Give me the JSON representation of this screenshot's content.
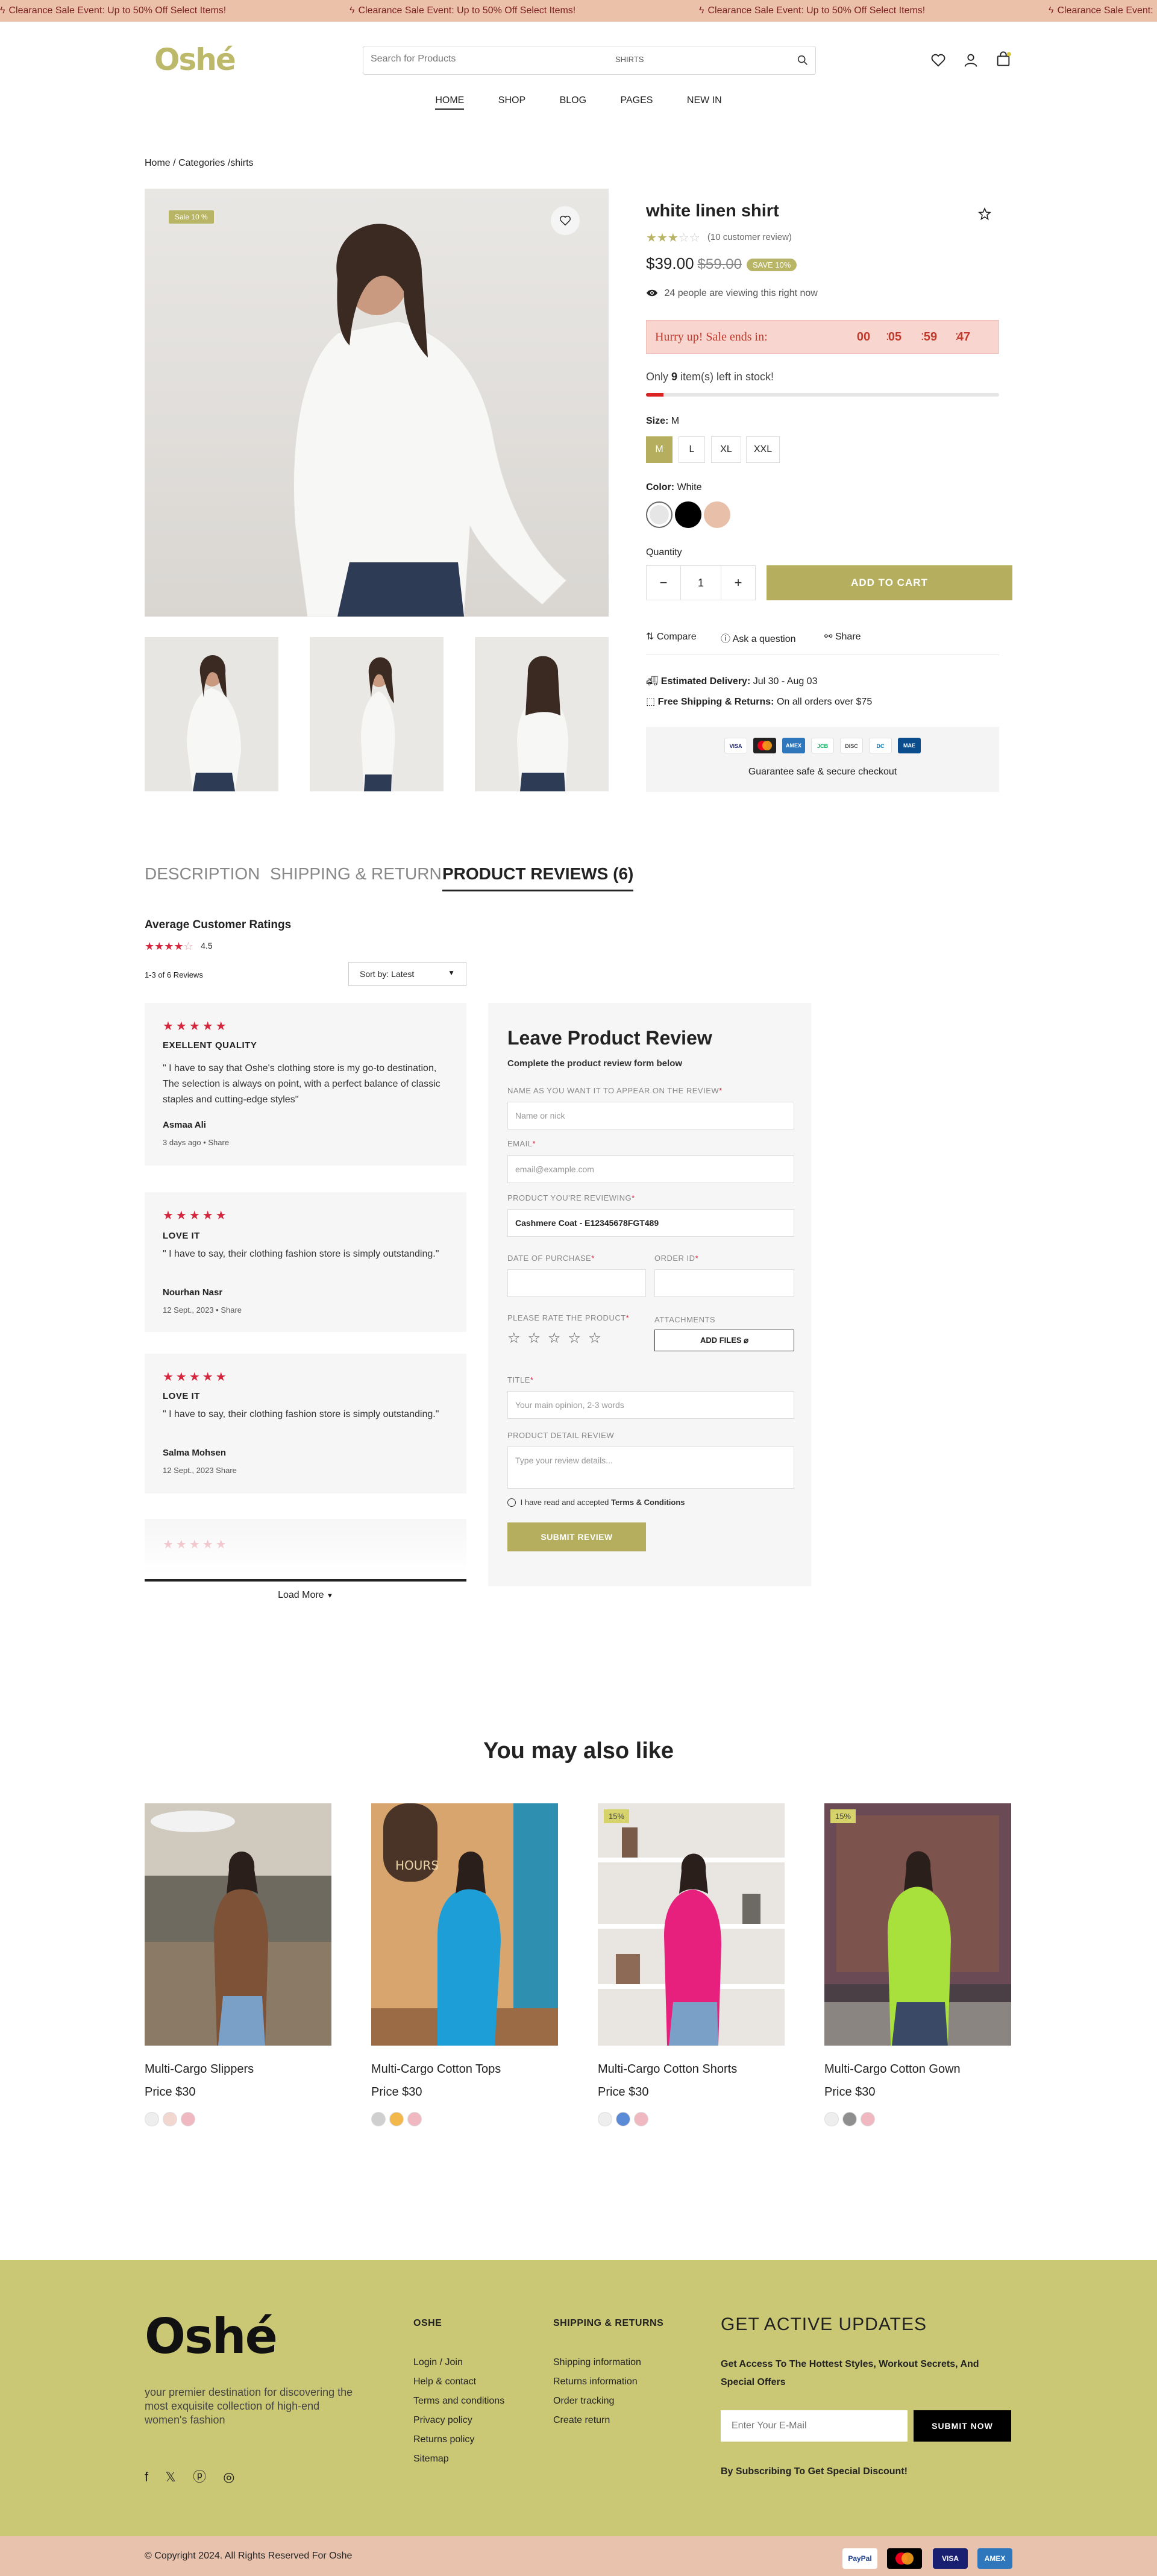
{
  "announcement": {
    "text": "Clearance Sale Event: Up to 50% Off Select Items!",
    "text2": "Clearance Sale Event: Up to 50% Off Select Items!",
    "text3": "Clearance Sale Event: Up to 50% Off Select Items!",
    "text4": "Clearance Sale Event:"
  },
  "header": {
    "logo": "Oshé",
    "search_placeholder": "Search for Products",
    "search_category": "SHIRTS",
    "nav": [
      "HOME",
      "SHOP",
      "BLOG",
      "PAGES",
      "NEW IN"
    ]
  },
  "breadcrumb": "Home / Categories /shirts",
  "product": {
    "sale_badge": "Sale 10 %",
    "title": "white linen shirt",
    "rating_value": 3,
    "review_count": "(10 customer review)",
    "price": "$39.00",
    "old_price": "$59.00",
    "save_badge": "SAVE 10%",
    "viewing": "24 people are viewing this right now",
    "hurry_label": "Hurry up! Sale ends in:",
    "countdown": [
      "00",
      "05",
      "59",
      "47"
    ],
    "stock_prefix": "Only ",
    "stock_count": "9",
    "stock_suffix": " item(s) left in stock!",
    "stock_fill_fraction": 0.05,
    "size_label": "Size:",
    "size_value": "M",
    "sizes": [
      "M",
      "L",
      "XL",
      "XXL"
    ],
    "color_label": "Color:",
    "color_value": "White",
    "colors": [
      "#e6e6e6",
      "#000000",
      "#e8c0aa"
    ],
    "quantity_label": "Quantity",
    "quantity": "1",
    "add_to_cart": "ADD TO CART",
    "compare": "Compare",
    "ask": "Ask a question",
    "share": "Share",
    "delivery_label": "Estimated Delivery:",
    "delivery_value": "Jul 30 - Aug 03",
    "shipping_label": "Free Shipping & Returns:",
    "shipping_value": "On all orders over $75",
    "secure_text": "Guarantee safe & secure checkout",
    "payment_cards": [
      "VISA",
      "MC",
      "AMEX",
      "JCB",
      "DISC",
      "DC",
      "MAE"
    ]
  },
  "tabs": [
    "DESCRIPTION",
    "SHIPPING & RETURN",
    "PRODUCT REVIEWS (6)"
  ],
  "reviews_summary": {
    "title": "Average Customer Ratings",
    "rating": "4.5",
    "count_text": "1-3 of 6 Reviews",
    "sort_label": "Sort by: Latest"
  },
  "reviews": [
    {
      "title": "EXELLENT QUALITY",
      "body": "\" I have to say that Oshe's clothing store is my go-to destination, The selection is always on point, with a perfect balance of classic staples and cutting-edge styles\"",
      "author": "Asmaa Ali",
      "meta": "3 days ago  •  Share"
    },
    {
      "title": "LOVE IT",
      "body": "\" I have to say, their clothing fashion store is simply outstanding.\"",
      "author": "Nourhan Nasr",
      "meta": "12 Sept., 2023  •  Share"
    },
    {
      "title": "LOVE IT",
      "body": "\" I have to say, their clothing fashion store is simply outstanding.\"",
      "author": "Salma Mohsen",
      "meta": "12 Sept., 2023     Share"
    }
  ],
  "load_more": "Load More",
  "review_form": {
    "heading": "Leave Product Review",
    "subheading": "Complete the product review form below",
    "name_label": "NAME AS YOU WANT IT TO APPEAR ON THE REVIEW",
    "name_placeholder": "Name or nick",
    "email_label": "EMAIL",
    "email_placeholder": "email@example.com",
    "product_label": "PRODUCT YOU'RE REVIEWING",
    "product_value": "Cashmere Coat - E12345678FGT489",
    "date_label": "DATE OF PURCHASE",
    "order_label": "ORDER ID",
    "rate_label": "PLEASE RATE THE PRODUCT",
    "attach_label": "ATTACHMENTS",
    "attach_button": "ADD FILES",
    "title_label": "TITLE",
    "title_placeholder": "Your main opinion, 2-3 words",
    "detail_label": "PRODUCT DETAIL REVIEW",
    "detail_placeholder": "Type your review details...",
    "terms_text": "I have read and accepted",
    "terms_link": "Terms & Conditions",
    "submit": "SUBMIT REVIEW"
  },
  "related": {
    "heading": "You may also like",
    "items": [
      {
        "name": "Multi-Cargo Slippers",
        "price": "Price $30",
        "badge": "",
        "swatches": [
          "#eeeeee",
          "#f2d6d0",
          "#f0b8c0"
        ]
      },
      {
        "name": "Multi-Cargo Cotton Tops",
        "price": "Price $30",
        "badge": "",
        "swatches": [
          "#cfcfcf",
          "#f2b84b",
          "#f0b8c0"
        ]
      },
      {
        "name": "Multi-Cargo Cotton Shorts",
        "price": "Price $30",
        "badge": "15%",
        "swatches": [
          "#eeeeee",
          "#5b8ad6",
          "#f0b8c0"
        ]
      },
      {
        "name": "Multi-Cargo Cotton Gown",
        "price": "Price $30",
        "badge": "15%",
        "swatches": [
          "#eeeeee",
          "#8f8f8f",
          "#f0b8c0"
        ]
      }
    ]
  },
  "footer": {
    "logo": "Oshé",
    "tagline": "your premier destination for discovering the most exquisite collection of high-end women's fashion",
    "col1_title": "OSHE",
    "col1_links": [
      "Login / Join",
      "Help & contact",
      "Terms and conditions",
      "Privacy policy",
      "Returns policy",
      "Sitemap"
    ],
    "col2_title": "SHIPPING & RETURNS",
    "col2_links": [
      "Shipping information",
      "Returns information",
      "Order tracking",
      "Create return"
    ],
    "updates_title": "GET ACTIVE UPDATES",
    "updates_text": "Get Access To The Hottest Styles, Workout Secrets, And Special Offers",
    "email_placeholder": "Enter Your E-Mail",
    "submit": "SUBMIT NOW",
    "discount_text": "By Subscribing To Get Special Discount!",
    "copyright": "Copyright 2024. All Rights Reserved For Oshe",
    "payment": [
      "PayPal",
      "MC",
      "VISA",
      "AMEX"
    ]
  }
}
